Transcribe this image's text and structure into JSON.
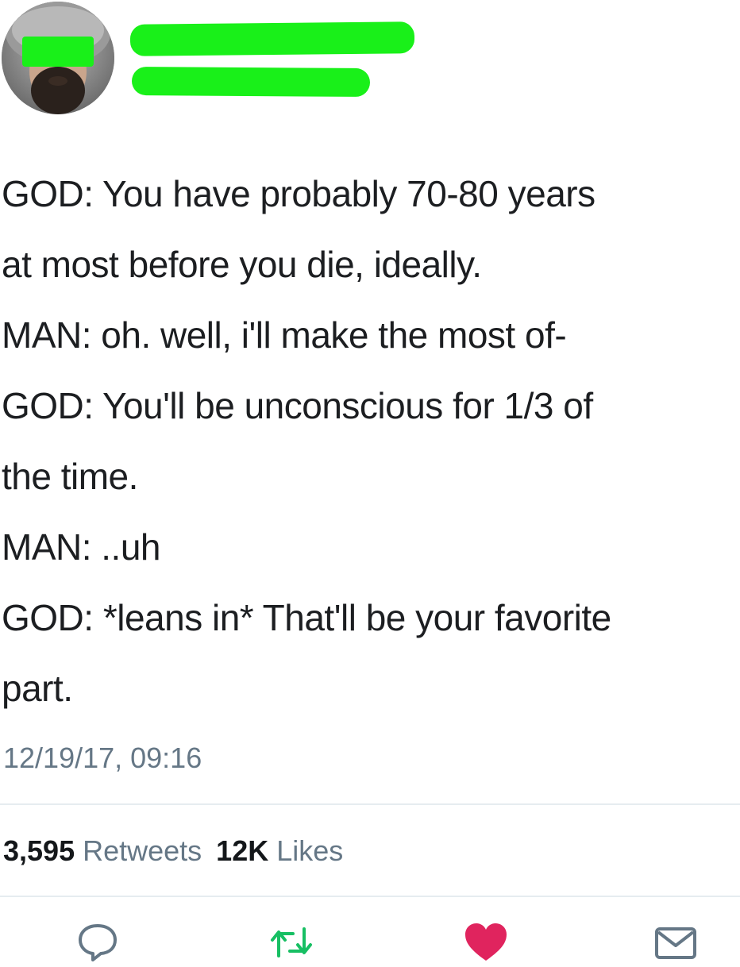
{
  "tweet": {
    "author": {
      "avatar_icon": "profile-photo",
      "name_redaction_color": "#19f019",
      "handle_redaction_color": "#19f019"
    },
    "lines": [
      "GOD: You have probably 70-80 years",
      "at most before you die, ideally.",
      "MAN: oh. well, i'll make the most of-",
      "GOD: You'll be unconscious for 1/3 of",
      "the time.",
      "MAN: ..uh",
      "GOD: *leans in* That'll be your favorite",
      "part."
    ],
    "timestamp": "12/19/17, 09:16",
    "stats": {
      "retweets_count": "3,595",
      "retweets_label": "Retweets",
      "likes_count": "12K",
      "likes_label": "Likes"
    },
    "actions": {
      "reply_icon": "reply-icon",
      "retweet_icon": "retweet-icon",
      "like_icon": "heart-icon",
      "dm_icon": "mail-icon"
    },
    "colors": {
      "retweet": "#17bf63",
      "like": "#e0245e",
      "secondary_text": "#657786",
      "icon_gray": "#657786"
    }
  }
}
